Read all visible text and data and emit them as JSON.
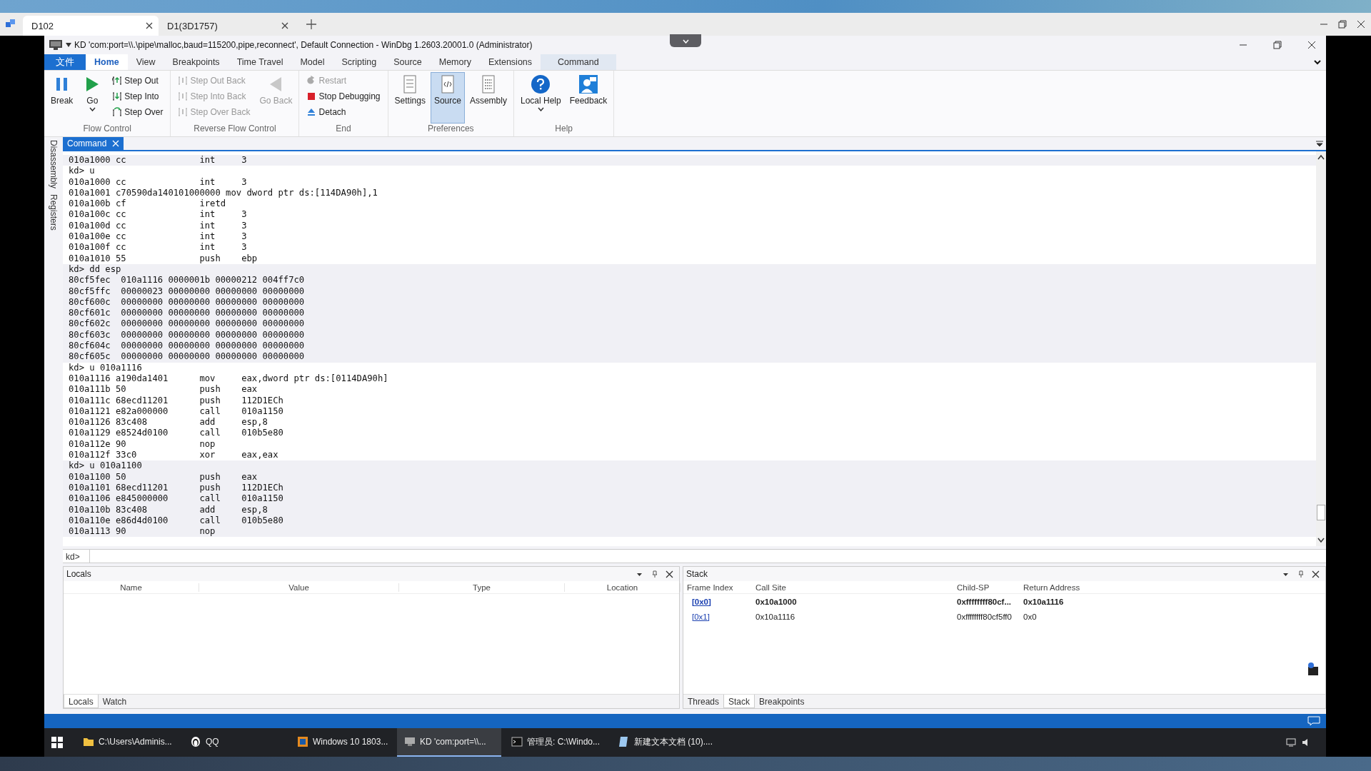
{
  "remote_tabs": [
    {
      "label": "D102",
      "selected": true
    },
    {
      "label": "D1(3D1757)",
      "selected": false
    }
  ],
  "window": {
    "title": "KD 'com:port=\\\\.\\pipe\\malloc,baud=115200,pipe,reconnect', Default Connection  - WinDbg 1.2603.20001.0 (Administrator)"
  },
  "ribbon_tabs": [
    {
      "label": "文件",
      "kind": "file",
      "selected": false
    },
    {
      "label": "Home",
      "kind": "normal",
      "selected": true
    },
    {
      "label": "View",
      "kind": "normal",
      "selected": false
    },
    {
      "label": "Breakpoints",
      "kind": "normal",
      "selected": false
    },
    {
      "label": "Time Travel",
      "kind": "normal",
      "selected": false
    },
    {
      "label": "Model",
      "kind": "normal",
      "selected": false
    },
    {
      "label": "Scripting",
      "kind": "normal",
      "selected": false
    },
    {
      "label": "Source",
      "kind": "normal",
      "selected": false
    },
    {
      "label": "Memory",
      "kind": "normal",
      "selected": false
    },
    {
      "label": "Extensions",
      "kind": "normal",
      "selected": false
    },
    {
      "label": "Command",
      "kind": "contextual",
      "selected": false
    }
  ],
  "ribbon_groups": [
    {
      "label": "Flow Control",
      "buttons": [
        {
          "label": "Break",
          "kind": "large",
          "disabled": false
        },
        {
          "label": "Go",
          "kind": "large",
          "disabled": false,
          "dropdown": true
        },
        {
          "label": "Step Out",
          "kind": "small",
          "disabled": false
        },
        {
          "label": "Step Into",
          "kind": "small",
          "disabled": false
        },
        {
          "label": "Step Over",
          "kind": "small",
          "disabled": false
        }
      ]
    },
    {
      "label": "Reverse Flow Control",
      "buttons": [
        {
          "label": "Step Out Back",
          "kind": "small",
          "disabled": true
        },
        {
          "label": "Step Into Back",
          "kind": "small",
          "disabled": true
        },
        {
          "label": "Step Over Back",
          "kind": "small",
          "disabled": true
        },
        {
          "label": "Go Back",
          "kind": "large",
          "disabled": true
        }
      ]
    },
    {
      "label": "End",
      "buttons": [
        {
          "label": "Restart",
          "kind": "small",
          "disabled": true
        },
        {
          "label": "Stop Debugging",
          "kind": "small",
          "disabled": false
        },
        {
          "label": "Detach",
          "kind": "small",
          "disabled": false
        }
      ]
    },
    {
      "label": "Preferences",
      "buttons": [
        {
          "label": "Settings",
          "kind": "large",
          "disabled": false,
          "selected": false
        },
        {
          "label": "Source",
          "kind": "large",
          "disabled": false,
          "selected": true
        },
        {
          "label": "Assembly",
          "kind": "large",
          "disabled": false,
          "selected": false
        }
      ]
    },
    {
      "label": "Help",
      "buttons": [
        {
          "label": "Local Help",
          "kind": "large",
          "disabled": false,
          "dropdown": true
        },
        {
          "label": "Feedback",
          "kind": "large",
          "disabled": false
        }
      ]
    }
  ],
  "document_tab": {
    "label": "Command"
  },
  "side_tabs": [
    "Disassembly",
    "Registers"
  ],
  "output_blocks": [
    {
      "shaded": true,
      "lines": [
        "010a1000 cc              int     3"
      ]
    },
    {
      "shaded": false,
      "lines": [
        "kd> u",
        "010a1000 cc              int     3",
        "010a1001 c70590da140101000000 mov dword ptr ds:[114DA90h],1",
        "010a100b cf              iretd",
        "010a100c cc              int     3",
        "010a100d cc              int     3",
        "010a100e cc              int     3",
        "010a100f cc              int     3",
        "010a1010 55              push    ebp"
      ]
    },
    {
      "shaded": true,
      "lines": [
        "kd> dd esp",
        "80cf5fec  010a1116 0000001b 00000212 004ff7c0",
        "80cf5ffc  00000023 00000000 00000000 00000000",
        "80cf600c  00000000 00000000 00000000 00000000",
        "80cf601c  00000000 00000000 00000000 00000000",
        "80cf602c  00000000 00000000 00000000 00000000",
        "80cf603c  00000000 00000000 00000000 00000000",
        "80cf604c  00000000 00000000 00000000 00000000",
        "80cf605c  00000000 00000000 00000000 00000000"
      ]
    },
    {
      "shaded": false,
      "lines": [
        "kd> u 010a1116",
        "010a1116 a190da1401      mov     eax,dword ptr ds:[0114DA90h]",
        "010a111b 50              push    eax",
        "010a111c 68ecd11201      push    112D1ECh",
        "010a1121 e82a000000      call    010a1150",
        "010a1126 83c408          add     esp,8",
        "010a1129 e8524d0100      call    010b5e80",
        "010a112e 90              nop",
        "010a112f 33c0            xor     eax,eax"
      ]
    },
    {
      "shaded": true,
      "lines": [
        "kd> u 010a1100",
        "010a1100 50              push    eax",
        "010a1101 68ecd11201      push    112D1ECh",
        "010a1106 e845000000      call    010a1150",
        "010a110b 83c408          add     esp,8",
        "010a110e e86d4d0100      call    010b5e80",
        "010a1113 90              nop"
      ]
    }
  ],
  "command_input": {
    "prompt": "kd>"
  },
  "locals_panel": {
    "title": "Locals",
    "columns": [
      "Name",
      "Value",
      "Type",
      "Location"
    ],
    "tabs": [
      {
        "label": "Locals",
        "selected": true
      },
      {
        "label": "Watch",
        "selected": false
      }
    ]
  },
  "stack_panel": {
    "title": "Stack",
    "columns": [
      "Frame Index",
      "Call Site",
      "Child-SP",
      "Return Address"
    ],
    "rows": [
      {
        "frame_index": "[0x0]",
        "call_site": "0x10a1000",
        "child_sp": "0xffffffff80cf...",
        "return_address": "0x10a1116",
        "current": true
      },
      {
        "frame_index": "[0x1]",
        "call_site": "0x10a1116",
        "child_sp": "0xffffffff80cf5ff0",
        "return_address": "0x0",
        "current": false
      }
    ],
    "tabs": [
      {
        "label": "Threads",
        "selected": false
      },
      {
        "label": "Stack",
        "selected": true
      },
      {
        "label": "Breakpoints",
        "selected": false
      }
    ]
  },
  "taskbar": {
    "items": [
      {
        "label": "C:\\Users\\Adminis...",
        "selected": false
      },
      {
        "label": "QQ",
        "selected": false
      },
      {
        "label": "Windows 10 1803...",
        "selected": false
      },
      {
        "label": "KD 'com:port=\\\\...",
        "selected": true
      },
      {
        "label": "管理员: C:\\Windo...",
        "selected": false
      },
      {
        "label": "新建文本文档 (10)....",
        "selected": false
      }
    ]
  }
}
